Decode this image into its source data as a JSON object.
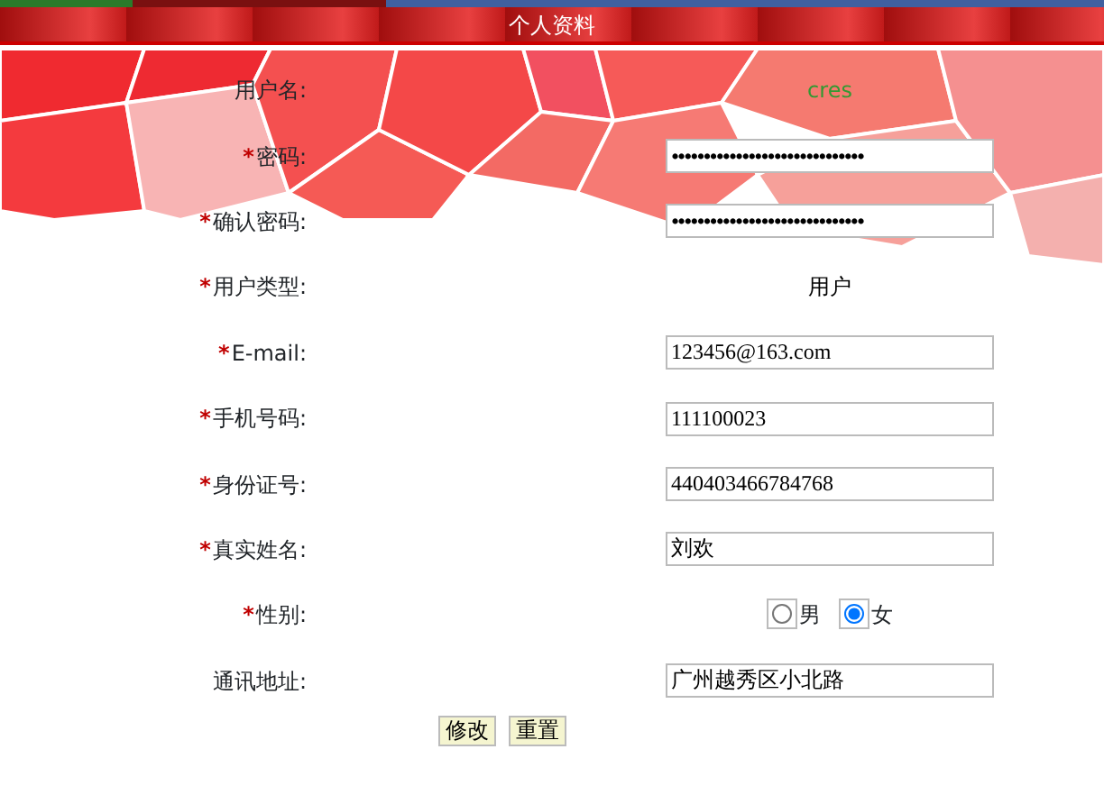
{
  "title": "个人资料",
  "fields": [
    {
      "label": "用户名:",
      "kind": "static",
      "value": "cres",
      "color": "#339933"
    },
    {
      "mark": "*",
      "label": "密码:",
      "kind": "input",
      "value": "••••••••••••••••••••••••••••••"
    },
    {
      "mark": "*",
      "label": "确认密码:",
      "kind": "input",
      "value": "••••••••••••••••••••••••••••••"
    },
    {
      "mark": "*",
      "label": "用户类型:",
      "kind": "static",
      "value": "用户",
      "color": "#000000"
    },
    {
      "mark": "*",
      "label": "E-mail:",
      "kind": "input",
      "value": "123456@163.com"
    },
    {
      "mark": "*",
      "label": "手机号码:",
      "kind": "input",
      "value": "111100023"
    },
    {
      "mark": "*",
      "label": "身份证号:",
      "kind": "input",
      "value": "440403466784768"
    },
    {
      "mark": "*",
      "label": "真实姓名:",
      "kind": "input",
      "value": "刘欢"
    },
    {
      "mark": "*",
      "label": "性别:",
      "kind": "radio",
      "options": [
        {
          "label": "男",
          "selected": false
        },
        {
          "label": "女",
          "selected": true
        }
      ]
    },
    {
      "label": "通讯地址:",
      "kind": "input",
      "value": "广州越秀区小北路"
    }
  ],
  "buttons": [
    "修改",
    "重置"
  ]
}
